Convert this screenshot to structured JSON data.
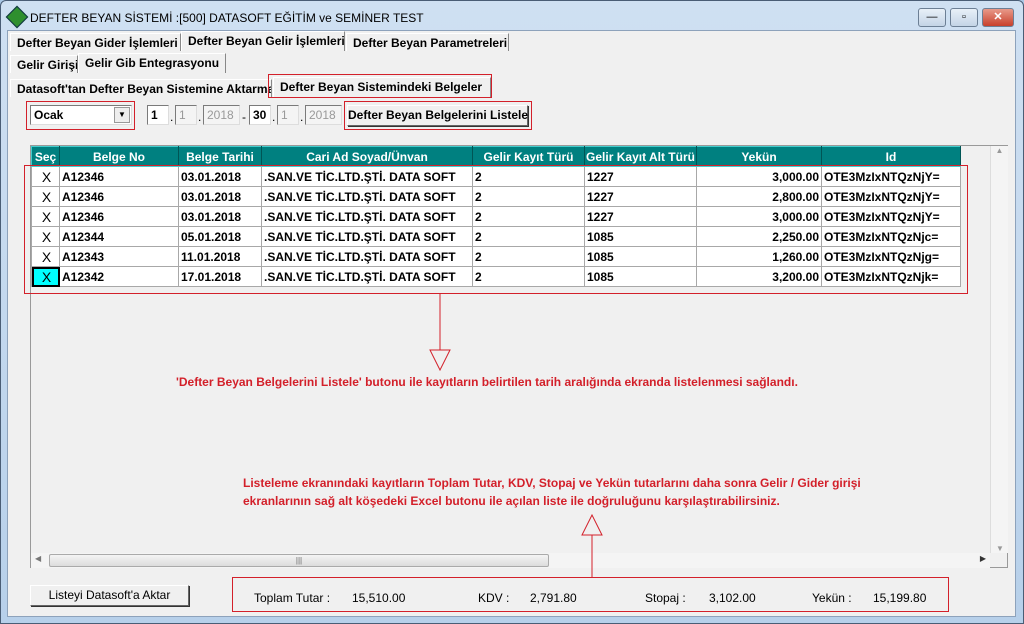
{
  "window": {
    "title": "DEFTER BEYAN SİSTEMİ :[500]  DATASOFT EĞİTİM ve SEMİNER TEST",
    "minimize": "—",
    "maximize": "▫",
    "close": "✕"
  },
  "tabs1": [
    "Defter Beyan Gider İşlemleri",
    "Defter Beyan Gelir İşlemleri",
    "Defter Beyan Parametreleri"
  ],
  "tabs2": [
    "Gelir Girişi",
    "Gelir Gib Entegrasyonu"
  ],
  "tabs3": [
    "Datasoft'tan Defter Beyan Sistemine Aktarma",
    "Defter Beyan Sistemindeki Belgeler"
  ],
  "filter": {
    "month": "Ocak",
    "start": {
      "day": "1",
      "month": "1",
      "year": "2018"
    },
    "end": {
      "day": "30",
      "month": "1",
      "year": "2018"
    },
    "list_button": "Defter Beyan Belgelerini Listele"
  },
  "grid": {
    "columns": [
      "Seç",
      "Belge No",
      "Belge Tarihi",
      "Cari Ad Soyad/Ünvan",
      "Gelir Kayıt Türü",
      "Gelir Kayıt Alt Türü",
      "Yekün",
      "Id"
    ],
    "rows": [
      [
        "X",
        "A12346",
        "03.01.2018",
        ".SAN.VE TİC.LTD.ŞTİ. DATA SOFT",
        "2",
        "1227",
        "3,000.00",
        "OTE3MzIxNTQzNjY="
      ],
      [
        "X",
        "A12346",
        "03.01.2018",
        ".SAN.VE TİC.LTD.ŞTİ. DATA SOFT",
        "2",
        "1227",
        "2,800.00",
        "OTE3MzIxNTQzNjY="
      ],
      [
        "X",
        "A12346",
        "03.01.2018",
        ".SAN.VE TİC.LTD.ŞTİ. DATA SOFT",
        "2",
        "1227",
        "3,000.00",
        "OTE3MzIxNTQzNjY="
      ],
      [
        "X",
        "A12344",
        "05.01.2018",
        ".SAN.VE TİC.LTD.ŞTİ. DATA SOFT",
        "2",
        "1085",
        "2,250.00",
        "OTE3MzIxNTQzNjc="
      ],
      [
        "X",
        "A12343",
        "11.01.2018",
        ".SAN.VE TİC.LTD.ŞTİ. DATA SOFT",
        "2",
        "1085",
        "1,260.00",
        "OTE3MzIxNTQzNjg="
      ],
      [
        "X",
        "A12342",
        "17.01.2018",
        ".SAN.VE TİC.LTD.ŞTİ. DATA SOFT",
        "2",
        "1085",
        "3,200.00",
        "OTE3MzIxNTQzNjk="
      ]
    ]
  },
  "notes": {
    "note1": "'Defter Beyan Belgelerini Listele' butonu ile  kayıtların belirtilen tarih aralığında ekranda listelenmesi sağlandı.",
    "note2_line1": "Listeleme ekranındaki kayıtların Toplam Tutar, KDV, Stopaj ve Yekün tutarlarını daha sonra Gelir / Gider girişi",
    "note2_line2": "ekranlarının sağ alt köşedeki Excel butonu ile açılan liste ile doğruluğunu karşılaştırabilirsiniz."
  },
  "footer": {
    "transfer_button": "Listeyi Datasoft'a Aktar",
    "totals": {
      "toplam_label": "Toplam Tutar :",
      "toplam": "15,510.00",
      "kdv_label": "KDV :",
      "kdv": "2,791.80",
      "stopaj_label": "Stopaj :",
      "stopaj": "3,102.00",
      "yekun_label": "Yekün :",
      "yekun": "15,199.80"
    }
  },
  "colors": {
    "header": "#008080",
    "annotation": "#d3202a",
    "selected_cell": "#00ffff"
  }
}
